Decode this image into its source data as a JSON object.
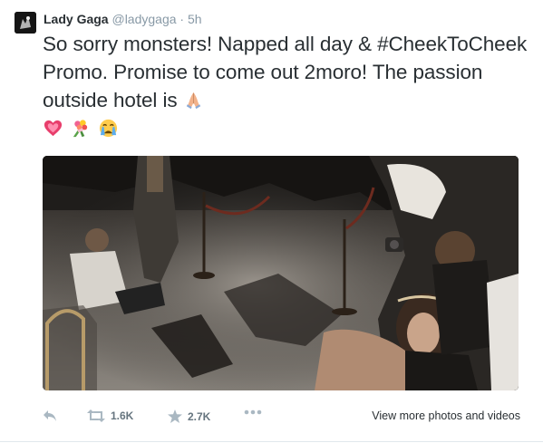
{
  "tweet": {
    "author_name": "Lady Gaga",
    "author_handle": "@ladygaga",
    "separator": "·",
    "timestamp": "5h",
    "text_part1": "So sorry monsters! Napped all day & ",
    "hashtag_hash": "#",
    "hashtag_word": "CheekToCheek",
    "text_part2": " Promo. Promise to come out 2moro! The passion outside hotel is ",
    "emojis": [
      "folded-hands-icon",
      "growing-heart-icon",
      "bouquet-icon",
      "crying-face-icon"
    ]
  },
  "actions": {
    "retweet_count": "1.6K",
    "favorite_count": "2.7K",
    "view_more_label": "View more photos and videos"
  },
  "colors": {
    "text": "#292f33",
    "muted": "#8899a6",
    "icon": "#aab8c2"
  }
}
